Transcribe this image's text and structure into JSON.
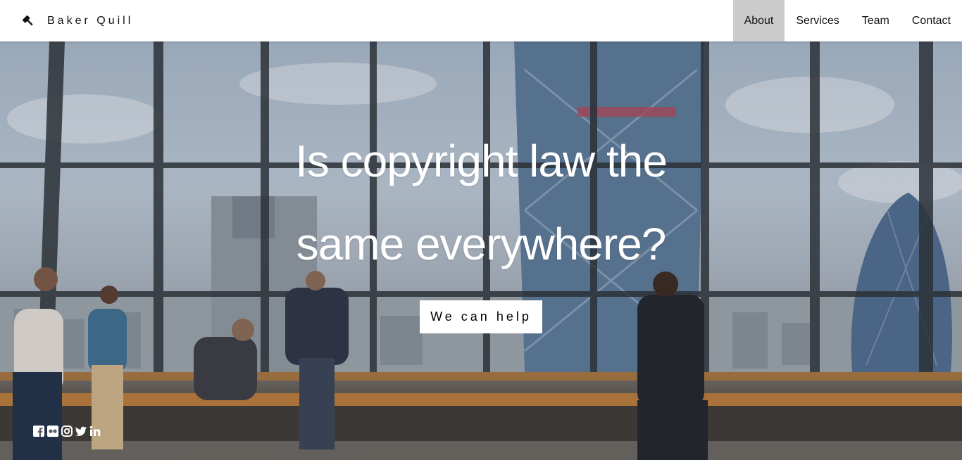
{
  "brand": {
    "name": "Baker Quill",
    "icon": "gavel-icon"
  },
  "nav": {
    "items": [
      {
        "label": "About",
        "active": true
      },
      {
        "label": "Services",
        "active": false
      },
      {
        "label": "Team",
        "active": false
      },
      {
        "label": "Contact",
        "active": false
      }
    ]
  },
  "hero": {
    "headline_line1": "Is copyright law the",
    "headline_line2": "same everywhere?",
    "cta_label": "We can help",
    "image": "office-skyline-photo"
  },
  "social": {
    "icons": [
      "facebook-icon",
      "flickr-icon",
      "instagram-icon",
      "twitter-icon",
      "linkedin-icon"
    ]
  },
  "colors": {
    "nav_bg": "#ffffff",
    "active_nav_bg": "#cccccc",
    "headline": "#ffffff",
    "cta_bg": "#ffffff"
  }
}
